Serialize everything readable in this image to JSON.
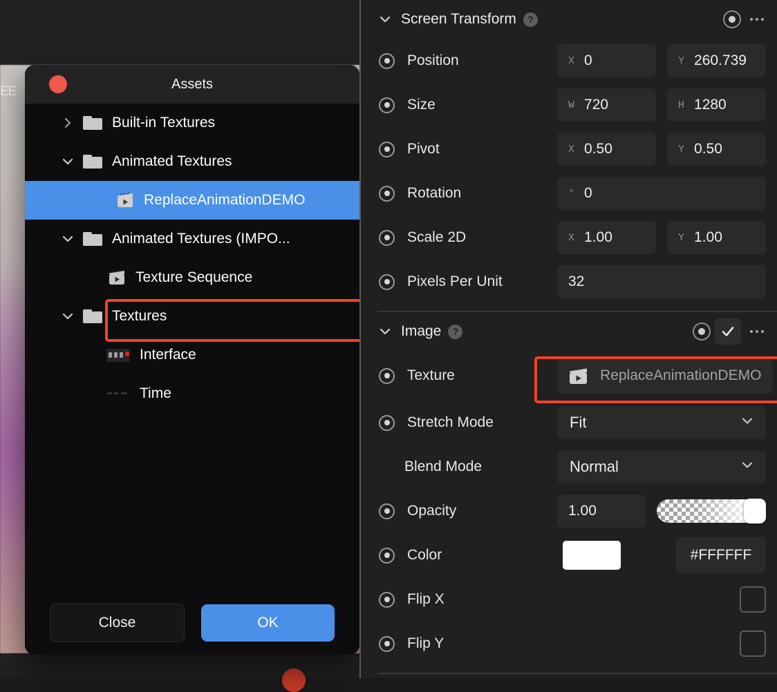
{
  "background": {
    "fragment_text": "EE"
  },
  "assets_dialog": {
    "title": "Assets",
    "close_dot": "close-window-dot",
    "tree": [
      {
        "label": "Built-in Textures",
        "icon": "folder-icon",
        "caret": "chevron-right",
        "indent": 0,
        "selected": false
      },
      {
        "label": "Animated Textures",
        "icon": "folder-icon",
        "caret": "chevron-down",
        "indent": 0,
        "selected": false
      },
      {
        "label": "ReplaceAnimationDEMO",
        "icon": "clapperboard-icon",
        "caret": "none",
        "indent": 1,
        "selected": true
      },
      {
        "label": "Animated Textures (IMPO...",
        "icon": "folder-icon",
        "caret": "chevron-down",
        "indent": 0,
        "selected": false
      },
      {
        "label": "Texture Sequence",
        "icon": "clapperboard-icon",
        "caret": "none",
        "indent": 1,
        "selected": false
      },
      {
        "label": "Textures",
        "icon": "folder-icon",
        "caret": "chevron-down",
        "indent": 0,
        "selected": false
      },
      {
        "label": "Interface",
        "icon": "texture-thumbnail-icon",
        "caret": "none",
        "indent": 1,
        "selected": false
      },
      {
        "label": "Time",
        "icon": "texture-thumbnail-faint-icon",
        "caret": "none",
        "indent": 1,
        "selected": false
      }
    ],
    "buttons": {
      "close": "Close",
      "ok": "OK"
    }
  },
  "inspector": {
    "screen_transform": {
      "title": "Screen Transform",
      "help": "?",
      "rows": [
        {
          "label": "Position",
          "fields": [
            {
              "axis": "X",
              "value": "0"
            },
            {
              "axis": "Y",
              "value": "260.739"
            }
          ]
        },
        {
          "label": "Size",
          "fields": [
            {
              "axis": "W",
              "value": "720"
            },
            {
              "axis": "H",
              "value": "1280"
            }
          ]
        },
        {
          "label": "Pivot",
          "fields": [
            {
              "axis": "X",
              "value": "0.50"
            },
            {
              "axis": "Y",
              "value": "0.50"
            }
          ]
        },
        {
          "label": "Rotation",
          "fields": [
            {
              "axis": "°",
              "value": "0"
            }
          ]
        },
        {
          "label": "Scale 2D",
          "fields": [
            {
              "axis": "X",
              "value": "1.00"
            },
            {
              "axis": "Y",
              "value": "1.00"
            }
          ]
        },
        {
          "label": "Pixels Per Unit",
          "fields": [
            {
              "axis": "",
              "value": "32"
            }
          ]
        }
      ]
    },
    "image": {
      "title": "Image",
      "help": "?",
      "enabled_checkmark": "✓",
      "texture": {
        "label": "Texture",
        "value": "ReplaceAnimationDEMO",
        "icon": "clapperboard-icon"
      },
      "stretch_mode": {
        "label": "Stretch Mode",
        "value": "Fit"
      },
      "blend_mode": {
        "label": "Blend Mode",
        "value": "Normal"
      },
      "opacity": {
        "label": "Opacity",
        "value": "1.00"
      },
      "color": {
        "label": "Color",
        "hex": "#FFFFFF",
        "swatch": "#FFFFFF"
      },
      "flip_x": {
        "label": "Flip X",
        "checked": false
      },
      "flip_y": {
        "label": "Flip Y",
        "checked": false
      }
    }
  },
  "accents": {
    "highlight_red": "#F04429",
    "selection_blue": "#4A90E8",
    "close_red": "#F0584C"
  }
}
